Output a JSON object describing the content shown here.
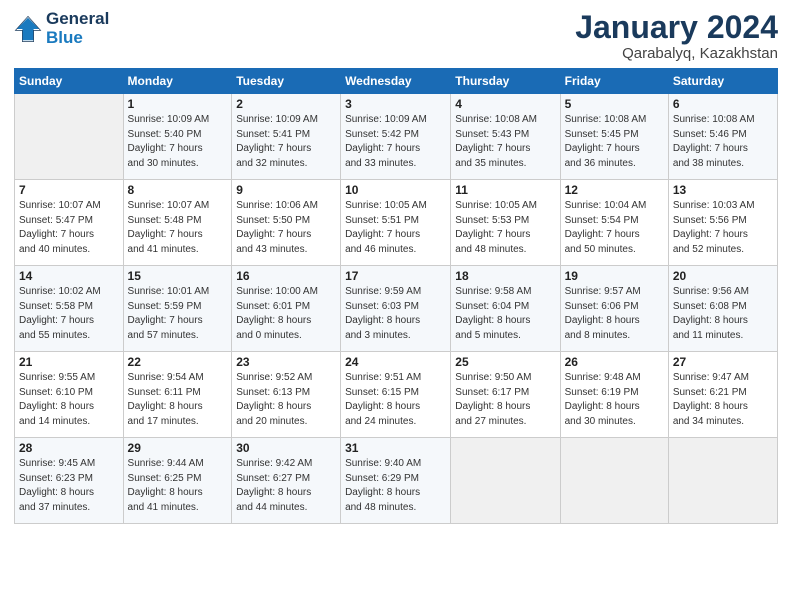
{
  "header": {
    "logo_line1": "General",
    "logo_line2": "Blue",
    "month": "January 2024",
    "location": "Qarabalyq, Kazakhstan"
  },
  "weekdays": [
    "Sunday",
    "Monday",
    "Tuesday",
    "Wednesday",
    "Thursday",
    "Friday",
    "Saturday"
  ],
  "weeks": [
    [
      {
        "day": "",
        "info": ""
      },
      {
        "day": "1",
        "info": "Sunrise: 10:09 AM\nSunset: 5:40 PM\nDaylight: 7 hours\nand 30 minutes."
      },
      {
        "day": "2",
        "info": "Sunrise: 10:09 AM\nSunset: 5:41 PM\nDaylight: 7 hours\nand 32 minutes."
      },
      {
        "day": "3",
        "info": "Sunrise: 10:09 AM\nSunset: 5:42 PM\nDaylight: 7 hours\nand 33 minutes."
      },
      {
        "day": "4",
        "info": "Sunrise: 10:08 AM\nSunset: 5:43 PM\nDaylight: 7 hours\nand 35 minutes."
      },
      {
        "day": "5",
        "info": "Sunrise: 10:08 AM\nSunset: 5:45 PM\nDaylight: 7 hours\nand 36 minutes."
      },
      {
        "day": "6",
        "info": "Sunrise: 10:08 AM\nSunset: 5:46 PM\nDaylight: 7 hours\nand 38 minutes."
      }
    ],
    [
      {
        "day": "7",
        "info": "Sunrise: 10:07 AM\nSunset: 5:47 PM\nDaylight: 7 hours\nand 40 minutes."
      },
      {
        "day": "8",
        "info": "Sunrise: 10:07 AM\nSunset: 5:48 PM\nDaylight: 7 hours\nand 41 minutes."
      },
      {
        "day": "9",
        "info": "Sunrise: 10:06 AM\nSunset: 5:50 PM\nDaylight: 7 hours\nand 43 minutes."
      },
      {
        "day": "10",
        "info": "Sunrise: 10:05 AM\nSunset: 5:51 PM\nDaylight: 7 hours\nand 46 minutes."
      },
      {
        "day": "11",
        "info": "Sunrise: 10:05 AM\nSunset: 5:53 PM\nDaylight: 7 hours\nand 48 minutes."
      },
      {
        "day": "12",
        "info": "Sunrise: 10:04 AM\nSunset: 5:54 PM\nDaylight: 7 hours\nand 50 minutes."
      },
      {
        "day": "13",
        "info": "Sunrise: 10:03 AM\nSunset: 5:56 PM\nDaylight: 7 hours\nand 52 minutes."
      }
    ],
    [
      {
        "day": "14",
        "info": "Sunrise: 10:02 AM\nSunset: 5:58 PM\nDaylight: 7 hours\nand 55 minutes."
      },
      {
        "day": "15",
        "info": "Sunrise: 10:01 AM\nSunset: 5:59 PM\nDaylight: 7 hours\nand 57 minutes."
      },
      {
        "day": "16",
        "info": "Sunrise: 10:00 AM\nSunset: 6:01 PM\nDaylight: 8 hours\nand 0 minutes."
      },
      {
        "day": "17",
        "info": "Sunrise: 9:59 AM\nSunset: 6:03 PM\nDaylight: 8 hours\nand 3 minutes."
      },
      {
        "day": "18",
        "info": "Sunrise: 9:58 AM\nSunset: 6:04 PM\nDaylight: 8 hours\nand 5 minutes."
      },
      {
        "day": "19",
        "info": "Sunrise: 9:57 AM\nSunset: 6:06 PM\nDaylight: 8 hours\nand 8 minutes."
      },
      {
        "day": "20",
        "info": "Sunrise: 9:56 AM\nSunset: 6:08 PM\nDaylight: 8 hours\nand 11 minutes."
      }
    ],
    [
      {
        "day": "21",
        "info": "Sunrise: 9:55 AM\nSunset: 6:10 PM\nDaylight: 8 hours\nand 14 minutes."
      },
      {
        "day": "22",
        "info": "Sunrise: 9:54 AM\nSunset: 6:11 PM\nDaylight: 8 hours\nand 17 minutes."
      },
      {
        "day": "23",
        "info": "Sunrise: 9:52 AM\nSunset: 6:13 PM\nDaylight: 8 hours\nand 20 minutes."
      },
      {
        "day": "24",
        "info": "Sunrise: 9:51 AM\nSunset: 6:15 PM\nDaylight: 8 hours\nand 24 minutes."
      },
      {
        "day": "25",
        "info": "Sunrise: 9:50 AM\nSunset: 6:17 PM\nDaylight: 8 hours\nand 27 minutes."
      },
      {
        "day": "26",
        "info": "Sunrise: 9:48 AM\nSunset: 6:19 PM\nDaylight: 8 hours\nand 30 minutes."
      },
      {
        "day": "27",
        "info": "Sunrise: 9:47 AM\nSunset: 6:21 PM\nDaylight: 8 hours\nand 34 minutes."
      }
    ],
    [
      {
        "day": "28",
        "info": "Sunrise: 9:45 AM\nSunset: 6:23 PM\nDaylight: 8 hours\nand 37 minutes."
      },
      {
        "day": "29",
        "info": "Sunrise: 9:44 AM\nSunset: 6:25 PM\nDaylight: 8 hours\nand 41 minutes."
      },
      {
        "day": "30",
        "info": "Sunrise: 9:42 AM\nSunset: 6:27 PM\nDaylight: 8 hours\nand 44 minutes."
      },
      {
        "day": "31",
        "info": "Sunrise: 9:40 AM\nSunset: 6:29 PM\nDaylight: 8 hours\nand 48 minutes."
      },
      {
        "day": "",
        "info": ""
      },
      {
        "day": "",
        "info": ""
      },
      {
        "day": "",
        "info": ""
      }
    ]
  ]
}
